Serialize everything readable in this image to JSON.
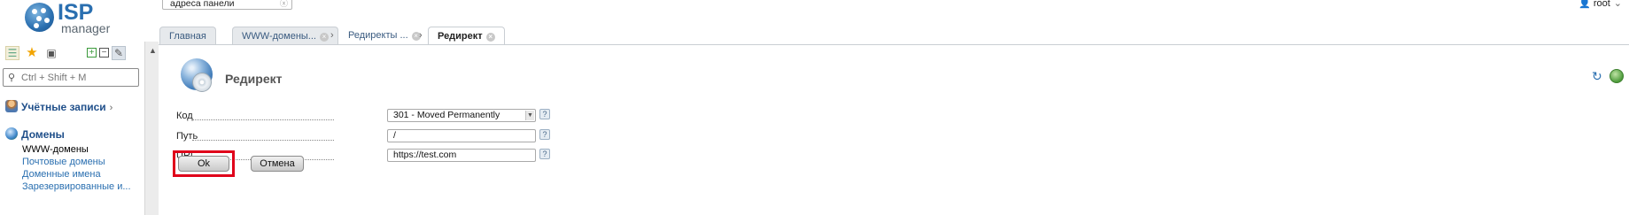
{
  "brand": {
    "logo_main": "ISP",
    "logo_sub": "manager"
  },
  "sidebar": {
    "toolbar_icons": [
      "list-icon",
      "star-icon",
      "camera-icon",
      "expand-icon",
      "collapse-icon",
      "pin-icon"
    ],
    "search": {
      "placeholder": "Ctrl + Shift + M"
    },
    "groups": [
      {
        "label": "Учётные записи",
        "icon": "user-accounts-icon",
        "items": []
      },
      {
        "label": "Домены",
        "icon": "globe-icon",
        "items": [
          {
            "label": "WWW-домены",
            "active": true
          },
          {
            "label": "Почтовые домены",
            "active": false
          },
          {
            "label": "Доменные имена",
            "active": false
          },
          {
            "label": "Зарезервированные и...",
            "active": false
          }
        ]
      }
    ]
  },
  "topbar": {
    "search_text": "адреса панели",
    "user": "root"
  },
  "tabs": [
    {
      "label": "Главная",
      "closable": false,
      "active": false
    },
    {
      "label": "WWW-домены...",
      "closable": true,
      "active": false
    },
    {
      "label": "Редиректы ...",
      "closable": true,
      "active": false
    },
    {
      "label": "Редирект",
      "closable": true,
      "active": true
    }
  ],
  "page": {
    "title": "Редирект",
    "fields": [
      {
        "label": "Код",
        "type": "select",
        "value": "301 - Moved Permanently"
      },
      {
        "label": "Путь",
        "type": "text",
        "value": "/"
      },
      {
        "label": "URL",
        "type": "text",
        "value": "https://test.com"
      }
    ],
    "buttons": {
      "ok": "Ok",
      "cancel": "Отмена"
    }
  },
  "colors": {
    "accent": "#2a6fb0",
    "highlight_border": "#e0001a"
  }
}
